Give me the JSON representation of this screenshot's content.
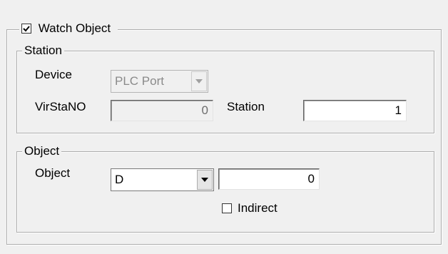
{
  "watch_object": {
    "label": "Watch Object",
    "checked": true
  },
  "station": {
    "group_label": "Station",
    "device_label": "Device",
    "device_value": "PLC Port",
    "virstano_label": "VirStaNO",
    "virstano_value": "0",
    "station_label": "Station",
    "station_value": "1"
  },
  "object": {
    "group_label": "Object",
    "object_label": "Object",
    "object_type_value": "D",
    "object_address_value": "0",
    "indirect_label": "Indirect",
    "indirect_checked": false
  },
  "icons": {
    "check": "check-icon",
    "dropdown": "chevron-down-icon"
  },
  "colors": {
    "background": "#f0f0f0",
    "group_border": "#adadad",
    "disabled_text": "#8a8a8a"
  }
}
